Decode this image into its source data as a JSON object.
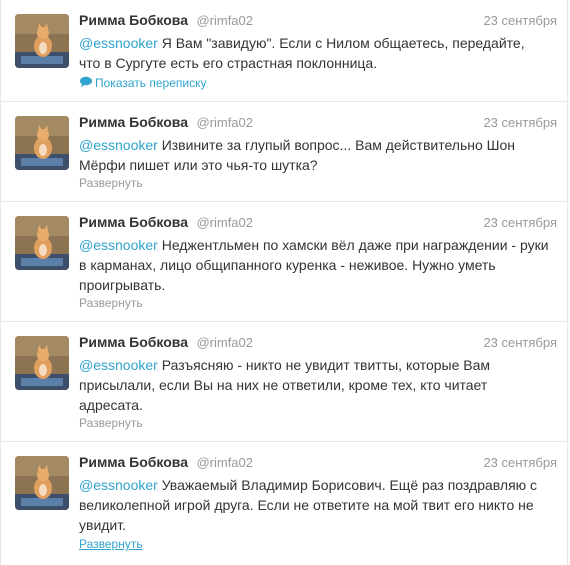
{
  "tweets": [
    {
      "name": "Римма Бобкова",
      "handle": "@rimfa02",
      "date": "23 сентября",
      "mention": "@essnooker",
      "text": " Я Вам \"завидую\". Если с Нилом общаетесь, передайте, что в Сургуте есть его страстная поклонница.",
      "action": "Показать переписку",
      "action_icon": "conversation-icon"
    },
    {
      "name": "Римма Бобкова",
      "handle": "@rimfa02",
      "date": "23 сентября",
      "mention": "@essnooker",
      "text": " Извините за глупый вопрос... Вам действительно Шон Мёрфи пишет или это чья-то шутка?",
      "action": "Развернуть"
    },
    {
      "name": "Римма Бобкова",
      "handle": "@rimfa02",
      "date": "23 сентября",
      "mention": "@essnooker",
      "text": " Неджентльмен по хамски вёл даже при награждении - руки в карманах, лицо общипанного куренка - неживое. Нужно уметь проигрывать.",
      "action": "Развернуть"
    },
    {
      "name": "Римма Бобкова",
      "handle": "@rimfa02",
      "date": "23 сентября",
      "mention": "@essnooker",
      "text": " Разъясняю - никто не увидит твитты, которые Вам присылали, если Вы на них не ответили, кроме тех, кто читает адресата.",
      "action": "Развернуть"
    },
    {
      "name": "Римма Бобкова",
      "handle": "@rimfa02",
      "date": "23 сентября",
      "mention": "@essnooker",
      "text": " Уважаемый Владимир Борисович. Ещё раз поздравляю с великолепной игрой друга. Если не ответите на мой твит его никто не увидит.",
      "action": "Развернуть"
    }
  ],
  "colors": {
    "link": "#2fa4cf",
    "muted": "#999999",
    "text": "#333333",
    "divider": "#e8e8e8"
  }
}
